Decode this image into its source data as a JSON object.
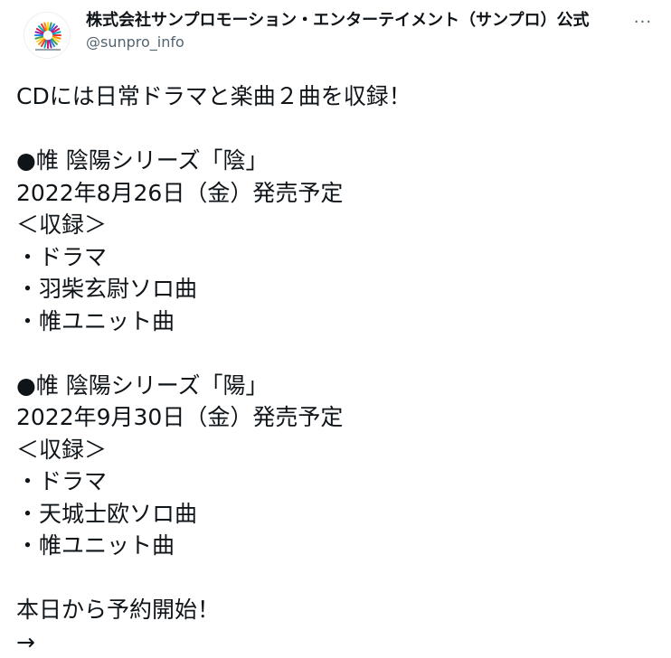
{
  "account": {
    "display_name": "株式会社サンプロモーション・エンターテイメント（サンプロ）公式",
    "handle": "@sunpro_info",
    "avatar_icon": "sunburst-logo-icon",
    "more_icon": "more-options-icon",
    "more_symbol": "···"
  },
  "tweet": {
    "lines": [
      "CDには日常ドラマと楽曲２曲を収録！",
      "",
      "●帷 陰陽シリーズ「陰」",
      "2022年8月26日（金）発売予定",
      "＜収録＞",
      "・ドラマ",
      "・羽柴玄尉ソロ曲",
      "・帷ユニット曲",
      "",
      "●帷 陰陽シリーズ「陽」",
      "2022年9月30日（金）発売予定",
      "＜収録＞",
      "・ドラマ",
      "・天城士欧ソロ曲",
      "・帷ユニット曲",
      "",
      "本日から予約開始！",
      "→"
    ]
  },
  "colors": {
    "text": "#0f1419",
    "secondary": "#536471",
    "background": "#ffffff"
  }
}
